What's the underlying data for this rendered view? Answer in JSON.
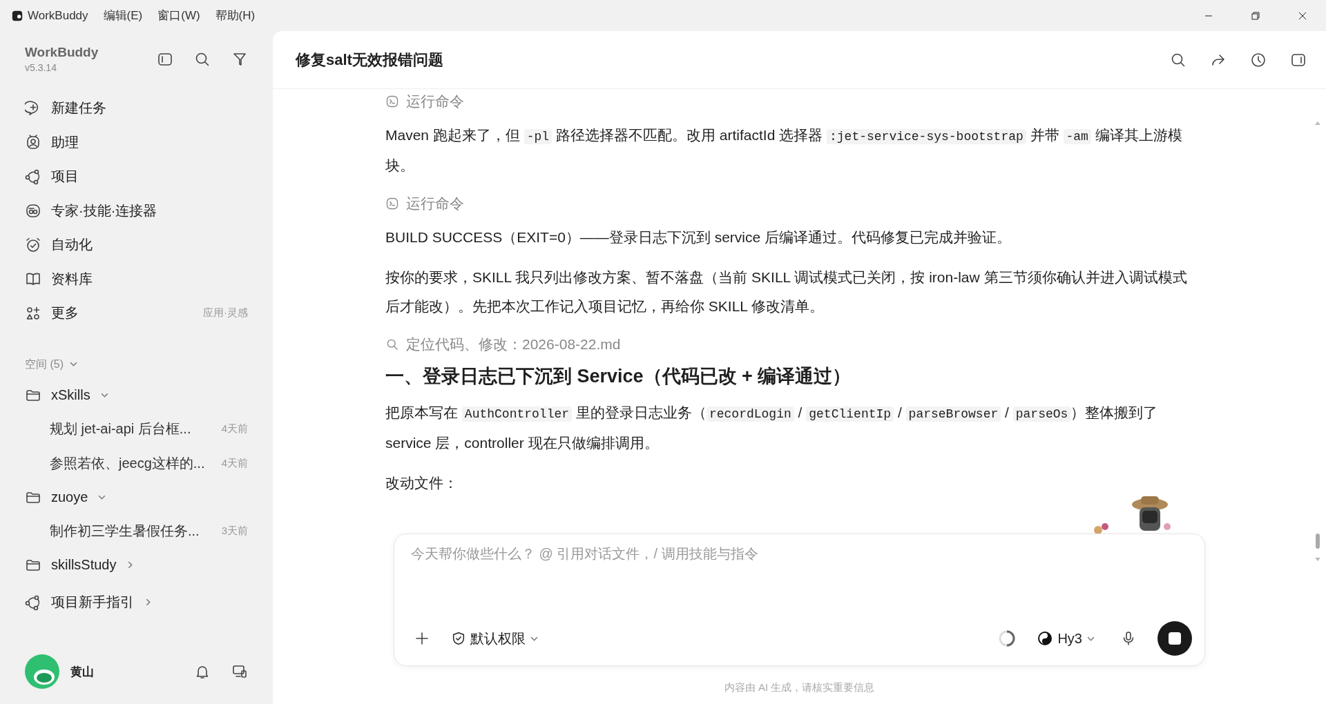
{
  "titlebar": {
    "app": "WorkBuddy",
    "menus": [
      "编辑(E)",
      "窗口(W)",
      "帮助(H)"
    ]
  },
  "sidebar": {
    "app_name": "WorkBuddy",
    "version": "v5.3.14",
    "items": [
      {
        "label": "新建任务"
      },
      {
        "label": "助理"
      },
      {
        "label": "项目"
      },
      {
        "label": "专家·技能·连接器"
      },
      {
        "label": "自动化"
      },
      {
        "label": "资料库"
      },
      {
        "label": "更多",
        "hint": "应用·灵感"
      }
    ],
    "spaces": {
      "label": "空间 (5)",
      "expanded": true,
      "folders": [
        {
          "name": "xSkills",
          "expanded": true,
          "tasks": [
            {
              "title": "规划 jet-ai-api 后台框...",
              "time": "4天前"
            },
            {
              "title": "参照若依、jeecg这样的...",
              "time": "4天前"
            }
          ]
        },
        {
          "name": "zuoye",
          "expanded": true,
          "tasks": [
            {
              "title": "制作初三学生暑假任务...",
              "time": "3天前"
            }
          ]
        },
        {
          "name": "skillsStudy",
          "expanded": false
        }
      ]
    },
    "guide": "项目新手指引",
    "user": {
      "name": "黄山"
    }
  },
  "chat": {
    "title": "修复salt无效报错问题",
    "blocks": [
      {
        "kind": "command",
        "text": "运行命令"
      },
      {
        "kind": "paragraph",
        "segments": [
          {
            "text": "Maven 跑起来了，但 ",
            "code": false
          },
          {
            "text": "-pl",
            "code": true
          },
          {
            "text": " 路径选择器不匹配。改用 artifactId 选择器 ",
            "code": false
          },
          {
            "text": ":jet-service-sys-bootstrap",
            "code": true
          },
          {
            "text": " 并带 ",
            "code": false
          },
          {
            "text": "-am",
            "code": true
          },
          {
            "text": " 编译其上游模块。",
            "code": false
          }
        ]
      },
      {
        "kind": "command",
        "text": "运行命令"
      },
      {
        "kind": "paragraph",
        "segments": [
          {
            "text": "BUILD SUCCESS（EXIT=0）——登录日志下沉到 service 后编译通过。代码修复已完成并验证。",
            "code": false
          }
        ]
      },
      {
        "kind": "paragraph",
        "segments": [
          {
            "text": "按你的要求，SKILL 我只列出修改方案、暂不落盘（当前 SKILL 调试模式已关闭，按 iron-law 第三节须你确认并进入调试模式后才能改）。先把本次工作记入项目记忆，再给你 SKILL 修改清单。",
            "code": false
          }
        ]
      },
      {
        "kind": "search",
        "text": "定位代码、修改：2026-08-22.md"
      },
      {
        "kind": "heading",
        "segments": [
          {
            "text": "一、登录日志已下沉到 Service（代码已改 + 编译通过）",
            "code": false
          }
        ]
      },
      {
        "kind": "paragraph",
        "segments": [
          {
            "text": "把原本写在 ",
            "code": false
          },
          {
            "text": "AuthController",
            "code": true
          },
          {
            "text": " 里的登录日志业务（",
            "code": false
          },
          {
            "text": "recordLogin",
            "code": true
          },
          {
            "text": " / ",
            "code": false
          },
          {
            "text": "getClientIp",
            "code": true
          },
          {
            "text": " / ",
            "code": false
          },
          {
            "text": "parseBrowser",
            "code": true
          },
          {
            "text": " / ",
            "code": false
          },
          {
            "text": "parseOs",
            "code": true
          },
          {
            "text": "）整体搬到了 service 层，controller 现在只做编排调用。",
            "code": false
          }
        ]
      },
      {
        "kind": "paragraph",
        "segments": [
          {
            "text": "改动文件：",
            "code": false
          }
        ]
      }
    ],
    "input": {
      "placeholder": "今天帮你做些什么？ @ 引用对话文件，/ 调用技能与指令",
      "permission": "默认权限",
      "model": "Hy3",
      "running": true
    },
    "disclaimer": "内容由 AI 生成，请核实重要信息"
  }
}
